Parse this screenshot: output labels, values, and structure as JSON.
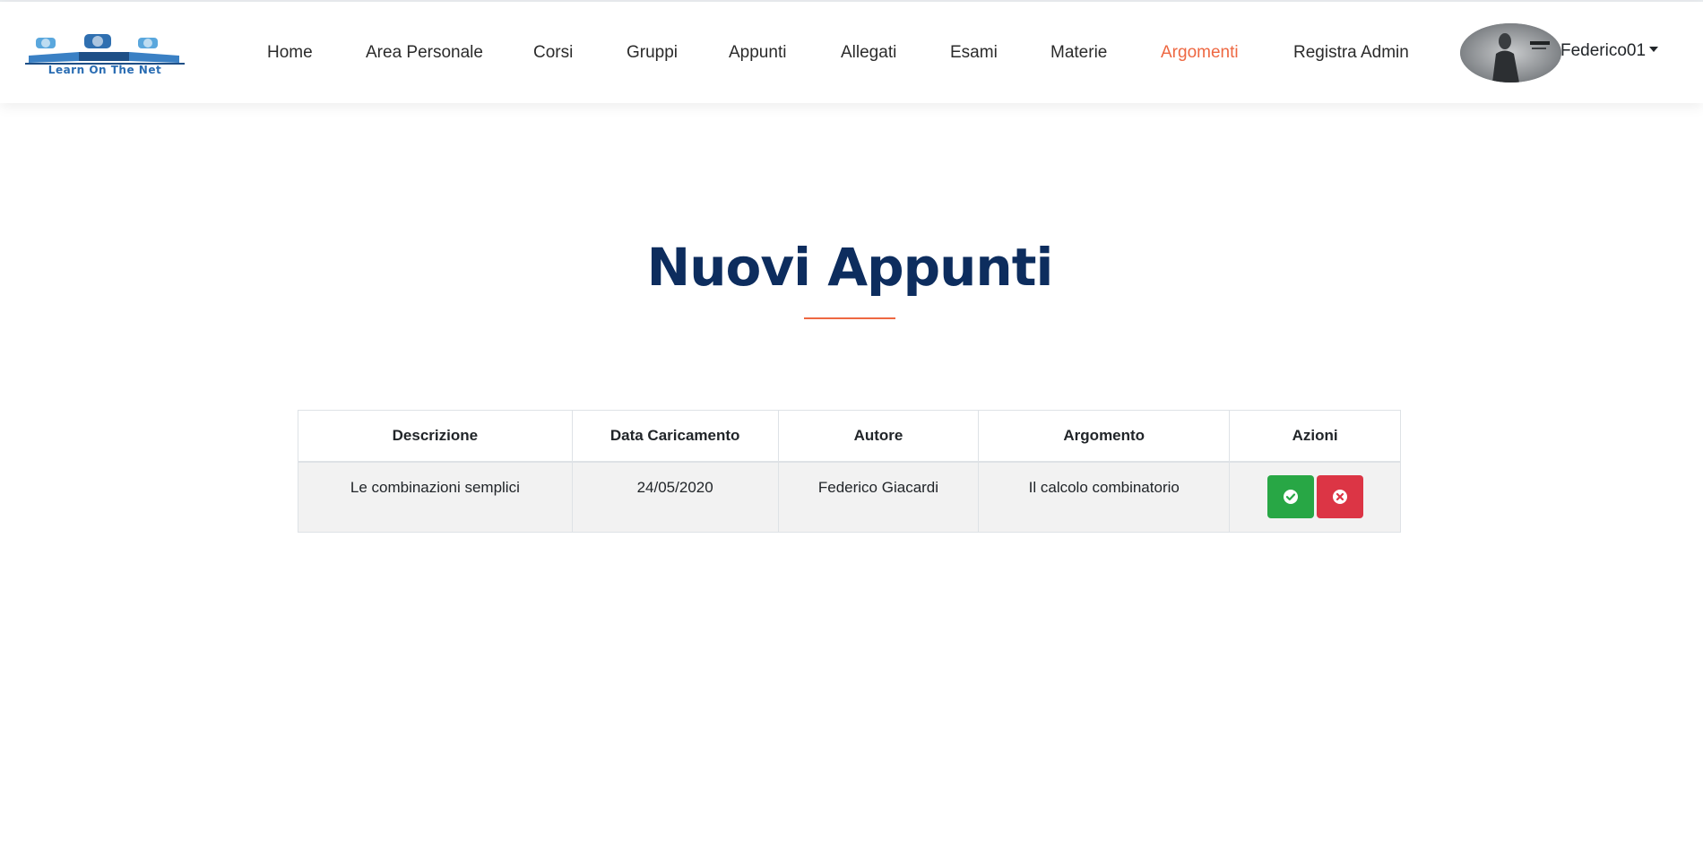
{
  "header": {
    "logo_text": "Learn On The Net",
    "nav": [
      {
        "label": "Home"
      },
      {
        "label": "Area Personale"
      },
      {
        "label": "Corsi"
      },
      {
        "label": "Gruppi"
      },
      {
        "label": "Appunti"
      },
      {
        "label": "Allegati"
      },
      {
        "label": "Esami"
      },
      {
        "label": "Materie"
      },
      {
        "label": "Argomenti",
        "active": true
      },
      {
        "label": "Registra Admin"
      }
    ],
    "user": {
      "name": "Federico01",
      "avatar_icon": "user-avatar-photo",
      "menu_icon": "caret-down-icon"
    }
  },
  "main": {
    "title": "Nuovi Appunti",
    "table": {
      "columns": [
        "Descrizione",
        "Data Caricamento",
        "Autore",
        "Argomento",
        "Azioni"
      ],
      "rows": [
        {
          "descrizione": "Le combinazioni semplici",
          "data_caricamento": "24/05/2020",
          "autore": "Federico Giacardi",
          "argomento": "Il calcolo combinatorio",
          "actions": [
            {
              "icon": "check-circle-icon",
              "color": "#28a745"
            },
            {
              "icon": "times-circle-icon",
              "color": "#dc3545"
            }
          ]
        }
      ]
    }
  },
  "colors": {
    "accent": "#ee6842",
    "title": "#0d2d5e",
    "success": "#28a745",
    "danger": "#dc3545",
    "row_background": "#f2f2f2"
  }
}
